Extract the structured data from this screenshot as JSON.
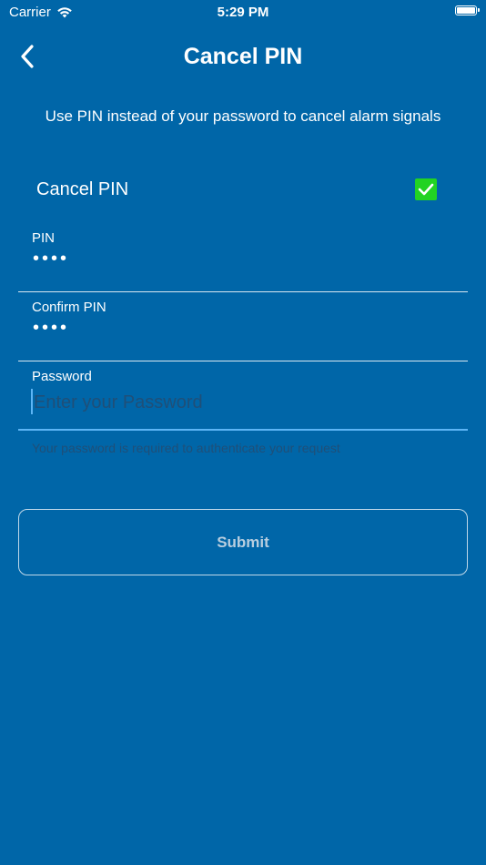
{
  "status_bar": {
    "carrier": "Carrier",
    "time": "5:29 PM",
    "wifi_icon": "wifi-icon",
    "battery_icon": "battery-icon"
  },
  "nav": {
    "title": "Cancel PIN",
    "back_icon": "chevron-left-icon"
  },
  "subtitle": "Use PIN instead of your password to cancel alarm signals",
  "toggle": {
    "label": "Cancel PIN",
    "checked": true,
    "check_color": "#22D322"
  },
  "fields": {
    "pin": {
      "label": "PIN",
      "value": "••••"
    },
    "confirm_pin": {
      "label": "Confirm PIN",
      "value": "••••"
    },
    "password": {
      "label": "Password",
      "value": "",
      "placeholder": "Enter your Password",
      "helper": "Your password is required to authenticate your request"
    }
  },
  "submit": {
    "label": "Submit"
  },
  "colors": {
    "background": "#0066A8",
    "accent": "#5DB5F5"
  }
}
